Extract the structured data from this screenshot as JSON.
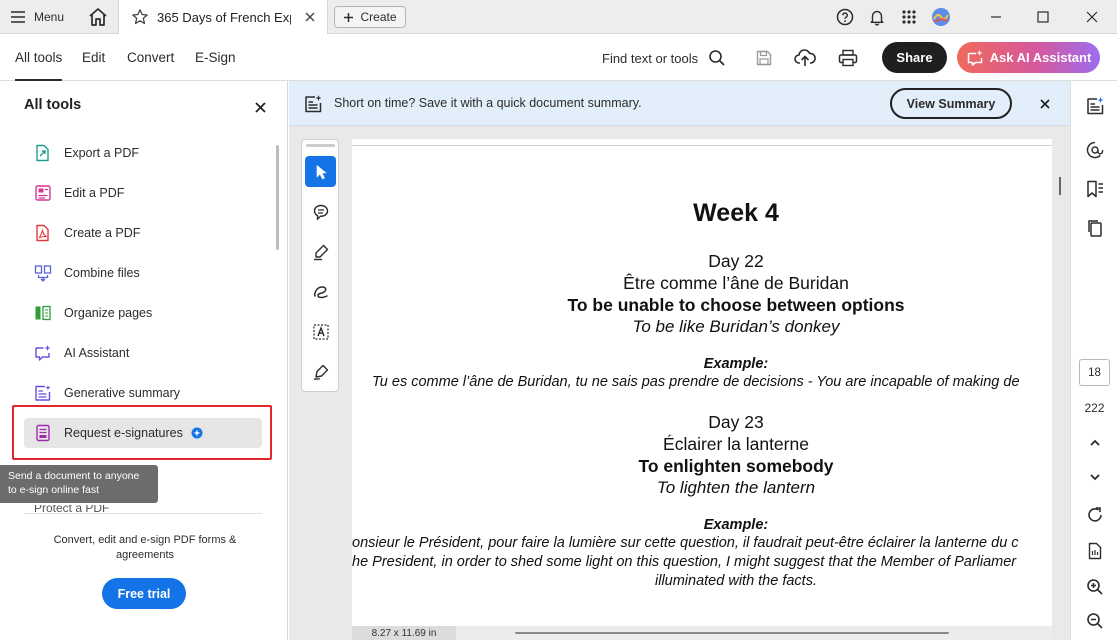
{
  "titlebar": {
    "menu_label": "Menu",
    "tab_title": "365 Days of French Expr...",
    "create_label": "Create"
  },
  "toolbar": {
    "tabs": [
      "All tools",
      "Edit",
      "Convert",
      "E-Sign"
    ],
    "active_tab": "All tools",
    "find_label": "Find text or tools",
    "share_label": "Share",
    "ai_label": "Ask AI Assistant"
  },
  "left_panel": {
    "title": "All tools",
    "items": [
      {
        "label": "Export a PDF",
        "icon": "export-pdf-icon",
        "color": "#1f9c8f"
      },
      {
        "label": "Edit a PDF",
        "icon": "edit-pdf-icon",
        "color": "#d83790"
      },
      {
        "label": "Create a PDF",
        "icon": "create-pdf-icon",
        "color": "#e0383e"
      },
      {
        "label": "Combine files",
        "icon": "combine-files-icon",
        "color": "#5a64d8"
      },
      {
        "label": "Organize pages",
        "icon": "organize-pages-icon",
        "color": "#2d9d3a"
      },
      {
        "label": "AI Assistant",
        "icon": "ai-assistant-icon",
        "color": "#6b4ee0"
      },
      {
        "label": "Generative summary",
        "icon": "generative-summary-icon",
        "color": "#6b4ee0"
      },
      {
        "label": "Request e-signatures",
        "icon": "request-esignature-icon",
        "color": "#a02bb0"
      }
    ],
    "tooltip": "Send a document to anyone to e-sign online fast",
    "partial_item": "Protect a PDF",
    "footer_text": "Convert, edit and e-sign PDF forms & agreements",
    "trial_label": "Free trial"
  },
  "banner": {
    "text": "Short on time? Save it with a quick document summary.",
    "button_label": "View Summary"
  },
  "document": {
    "heading": "Week 4",
    "day22": {
      "day": "Day 22",
      "french": "Être comme l’âne de Buridan",
      "meaning": "To be unable to choose between options",
      "literal": "To be like Buridan’s donkey",
      "example_label": "Example:",
      "example_text": "Tu es comme l’âne de Buridan, tu ne sais pas prendre de decisions - You are incapable of making de"
    },
    "day23": {
      "day": "Day 23",
      "french": "Éclairer la lanterne",
      "meaning": "To enlighten somebody",
      "literal": "To lighten the lantern",
      "example_label": "Example:",
      "example_line1": "onsieur le Président, pour faire la lumière sur cette question, il faudrait peut-être éclairer la lanterne du c",
      "example_line2": "he President, in order to shed some light on this question, I might suggest that the Member of Parliamer",
      "example_line3": "illuminated with the facts."
    },
    "page_size": "8.27 x 11.69 in"
  },
  "right_rail": {
    "current_page": "18",
    "total_pages": "222"
  },
  "colors": {
    "accent_blue": "#1473e6",
    "highlight_red": "#e2262b",
    "banner_bg": "#e2eef9"
  }
}
